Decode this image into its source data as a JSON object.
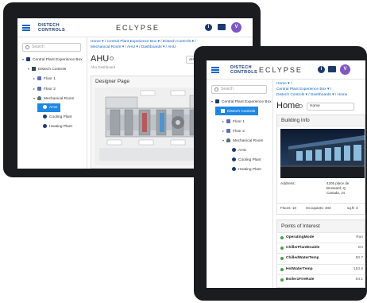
{
  "brand": {
    "line1": "DISTECH",
    "line2": "CONTROLS",
    "product": "ECLYPSE",
    "avatar": "V",
    "info_icon": "i"
  },
  "back": {
    "search_placeholder": "Search",
    "tree": [
      {
        "label": "Central Plant Experience Box",
        "icon": "site-icon",
        "expander": "▾"
      },
      {
        "label": "Distech Controls",
        "icon": "building-icon",
        "expander": "▾"
      },
      {
        "label": "Floor 1",
        "icon": "floor-icon",
        "expander": "▸"
      },
      {
        "label": "Floor 2",
        "icon": "floor-icon",
        "expander": "▸"
      },
      {
        "label": "Mechanical Room",
        "icon": "room-icon",
        "expander": "▾"
      },
      {
        "label": "AHU",
        "icon": "equipment-icon",
        "selected": true
      },
      {
        "label": "Cooling Plant",
        "icon": "equipment-icon"
      },
      {
        "label": "Heating Plant",
        "icon": "equipment-icon"
      }
    ],
    "breadcrumbs_line1": "Home ▾ / Central Plant Experience Box ▾ / Distech Controls ▾ /",
    "breadcrumbs_line2": "Mechanical Room ▾ / AHU ▾ / Dashboards ▾ / AHU",
    "title": "AHU",
    "subtitle": "Ahu Dashboard",
    "action": "AH",
    "panel_title": "Designer Page"
  },
  "front": {
    "search_placeholder": "Search",
    "tree": [
      {
        "label": "Central Plant Experience Box",
        "icon": "site-icon",
        "expander": "▾"
      },
      {
        "label": "Distech Controls",
        "icon": "building-icon",
        "expander": "▾",
        "selected": true
      },
      {
        "label": "Floor 1",
        "icon": "floor-icon",
        "expander": "▸"
      },
      {
        "label": "Floor 2",
        "icon": "floor-icon",
        "expander": "▸"
      },
      {
        "label": "Mechanical Room",
        "icon": "room-icon",
        "expander": "▾"
      },
      {
        "label": "AHU",
        "icon": "equipment-icon"
      },
      {
        "label": "Cooling Plant",
        "icon": "equipment-icon"
      },
      {
        "label": "Heating Plant",
        "icon": "equipment-icon"
      }
    ],
    "breadcrumbs_line1": "Home ▾ /",
    "breadcrumbs_line2": "Central Plant Experience Box ▾ /",
    "breadcrumbs_line3": "Distech Controls ▾ / Dashboards ▾ / Home",
    "title": "Home",
    "select_value": "Home",
    "building_info": {
      "title": "Building Info",
      "address_label": "Address:",
      "address_lines": [
        "4205 place de",
        "Brossard, Q",
        "Canada, J4"
      ],
      "floors": "Floors: 10",
      "occupants": "Occupants: 403",
      "sqft": "sq.ft: 3"
    },
    "points_title": "Points of Interest",
    "points": [
      {
        "name": "OperatingMode",
        "value": "Run"
      },
      {
        "name": "ChillerPlantEnable",
        "value": "En"
      },
      {
        "name": "ChilledWaterTemp",
        "value": "50.7"
      },
      {
        "name": "HotWaterTemp",
        "value": "153.6"
      },
      {
        "name": "Boiler1FireRate",
        "value": "64.1"
      }
    ]
  }
}
